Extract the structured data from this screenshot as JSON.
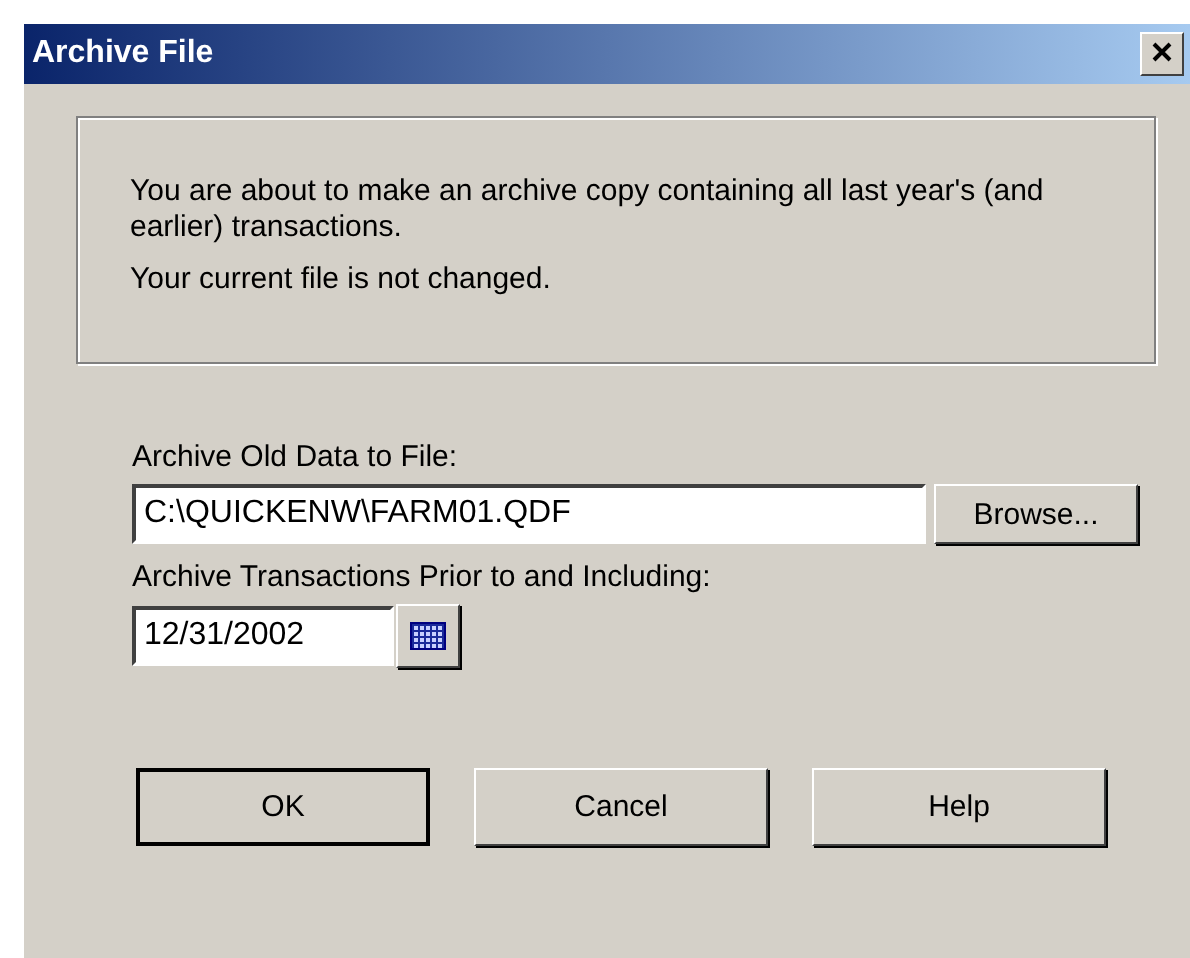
{
  "window": {
    "title": "Archive File"
  },
  "info": [
    "You are about to make an archive copy containing all last year's (and earlier) transactions.",
    "Your current file is not changed."
  ],
  "file_field": {
    "label": "Archive Old Data to File:",
    "value": "C:\\QUICKENW\\FARM01.QDF",
    "browse": "Browse..."
  },
  "date_field": {
    "label": "Archive Transactions Prior to and Including:",
    "value": "12/31/2002"
  },
  "buttons": [
    {
      "label": "OK",
      "default": true
    },
    {
      "label": "Cancel",
      "default": false
    },
    {
      "label": "Help",
      "default": false
    }
  ]
}
